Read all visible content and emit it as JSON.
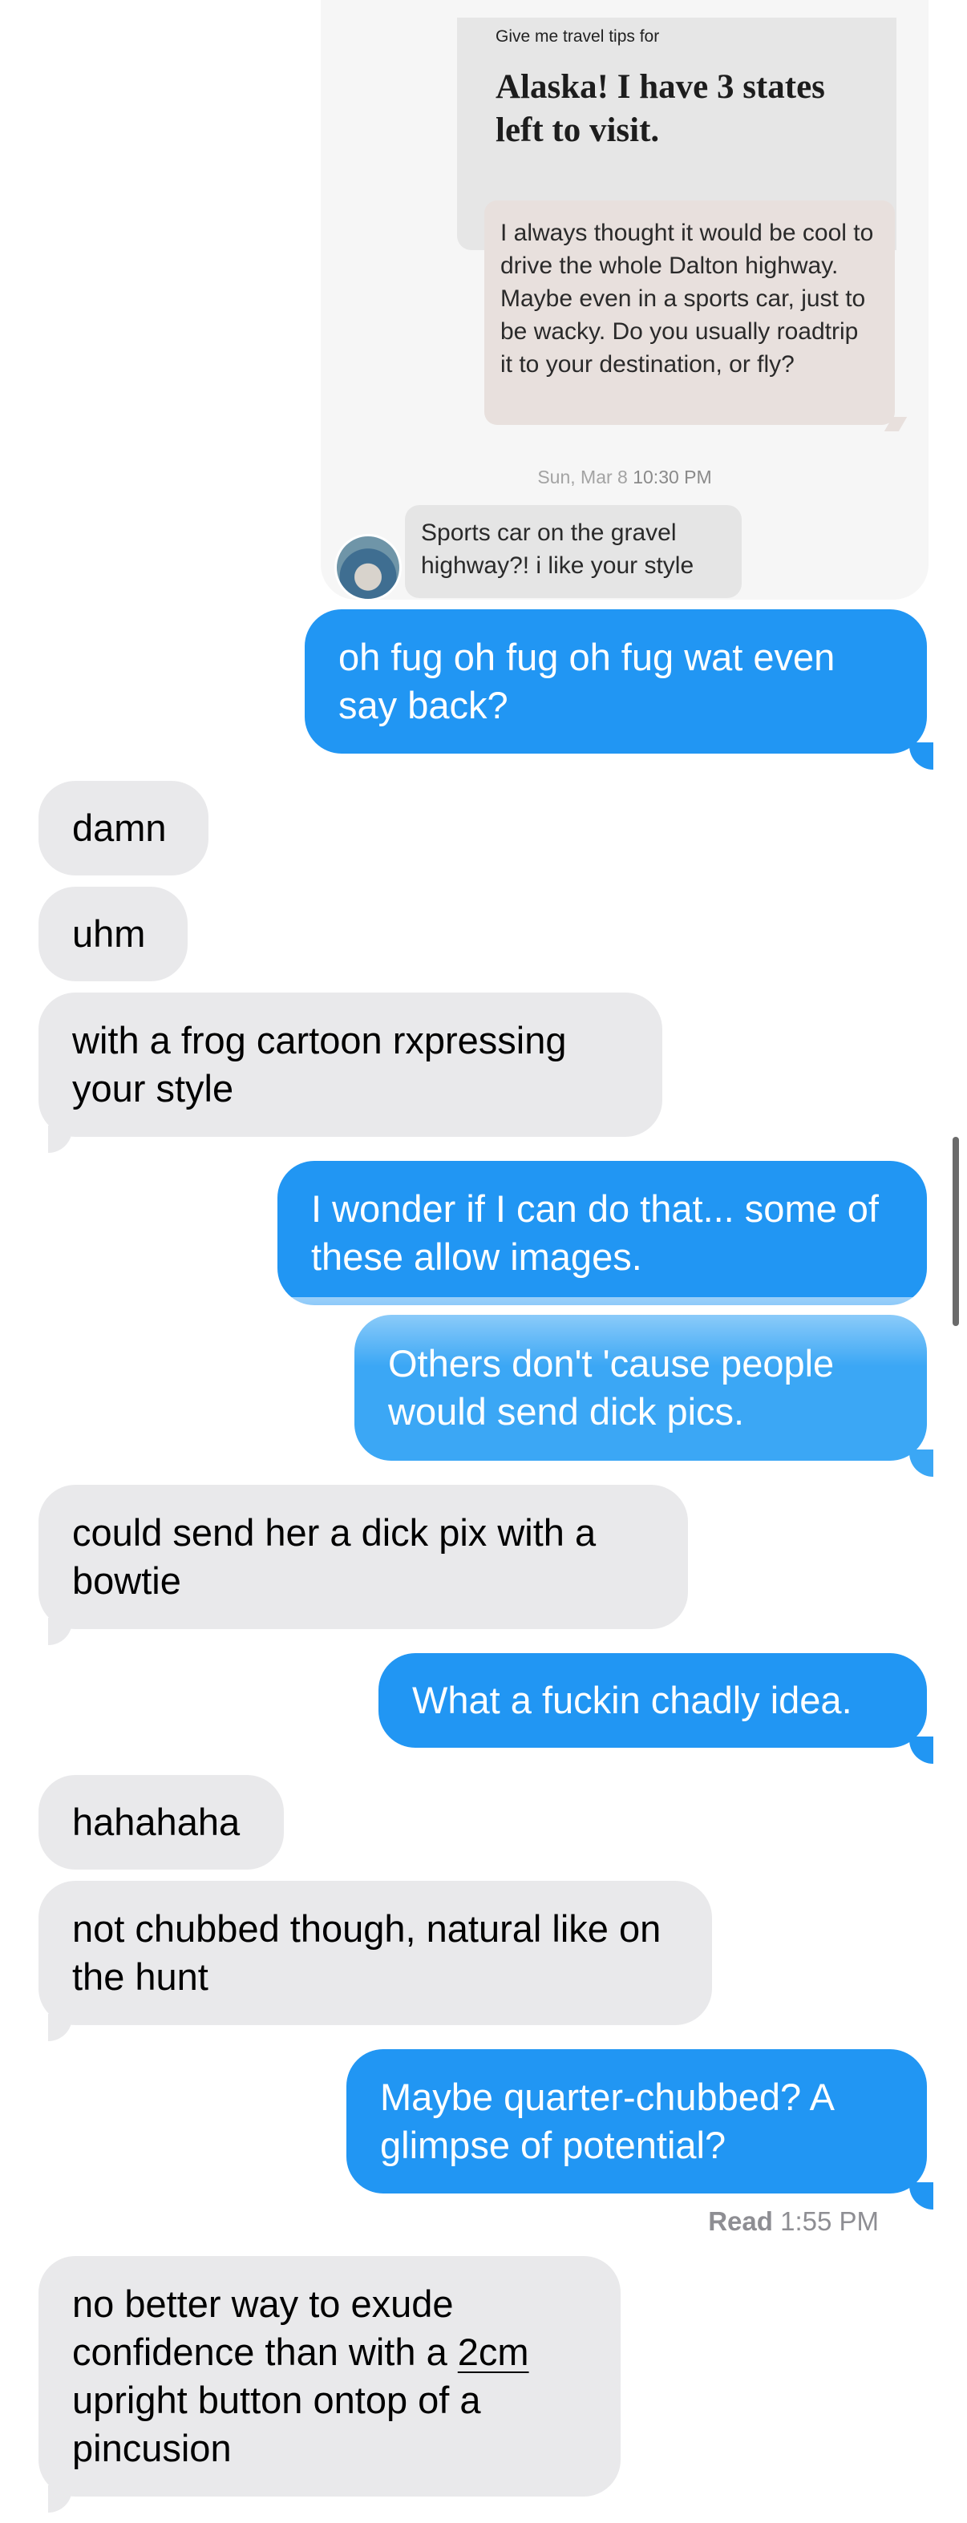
{
  "card": {
    "prompt_label": "Give me travel tips for",
    "prompt_answer": "Alaska! I have 3 states left to visit.",
    "comment": "I always thought it would be cool to drive the whole Dalton highway. Maybe even in a sports car, just to be wacky. Do you usually roadtrip it to your destination, or fly?",
    "timestamp_day": "Sun, Mar 8",
    "timestamp_time": "10:30 PM",
    "reply": "Sports car on the gravel highway?! i like your style"
  },
  "messages": {
    "m1": "oh fug oh fug oh fug wat even say back?",
    "m2": "damn",
    "m3": "uhm",
    "m4": "with a frog cartoon rxpressing your style",
    "m5": "I wonder if I can do that... some of these allow images.",
    "m6": "Others don't 'cause people would send dick pics.",
    "m7": "could send her a dick pix with a bowtie",
    "m8": "What a fuckin chadly idea.",
    "m9": "hahahaha",
    "m10": "not chubbed though, natural like on the hunt",
    "m11": "Maybe quarter-chubbed? A glimpse of potential?",
    "m12_a": "no better way to exude confidence than with a ",
    "m12_link": "2cm",
    "m12_b": " upright button ontop of a pincusion"
  },
  "read_receipt": {
    "label": "Read",
    "time": "1:55 PM"
  },
  "colors": {
    "sent": "#2196f3",
    "received": "#e9e9eb"
  }
}
